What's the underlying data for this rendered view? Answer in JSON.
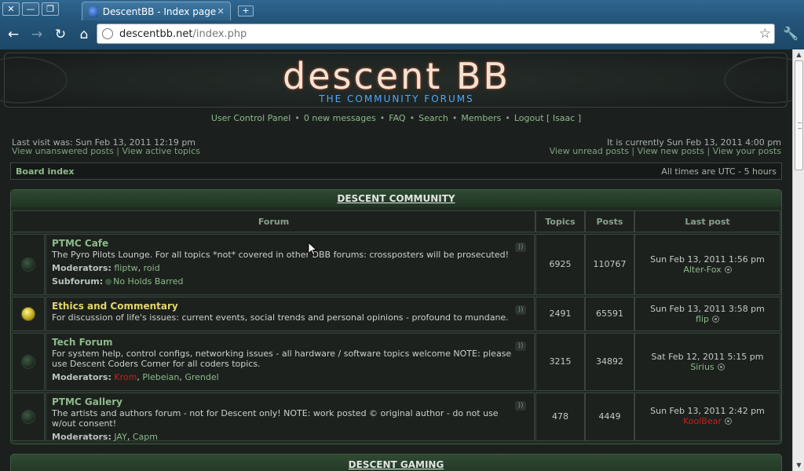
{
  "browser": {
    "tab_title": "DescentBB - Index page",
    "url_host": "descentbb.net",
    "url_path": "/index.php",
    "new_tab_symbol": "+"
  },
  "header": {
    "logo_main": "descent BB",
    "logo_sub": "THE COMMUNITY FORUMS"
  },
  "topnav": [
    {
      "label": "User Control Panel"
    },
    {
      "label": "0 new messages"
    },
    {
      "label": "FAQ"
    },
    {
      "label": "Search"
    },
    {
      "label": "Members"
    },
    {
      "label": "Logout [ Isaac ]"
    }
  ],
  "info": {
    "last_visit": "Last visit was: Sun Feb 13, 2011 12:19 pm",
    "view_unanswered": "View unanswered posts",
    "view_active": "View active topics",
    "current_time": "It is currently Sun Feb 13, 2011 4:00 pm",
    "view_unread": "View unread posts",
    "view_new": "View new posts",
    "view_yours": "View your posts"
  },
  "breadcrumbs": {
    "board_index": "Board index",
    "timezone": "All times are UTC - 5 hours"
  },
  "categories": [
    {
      "title": "DESCENT COMMUNITY"
    },
    {
      "title": "DESCENT GAMING"
    }
  ],
  "columns": {
    "forum": "Forum",
    "topics": "Topics",
    "posts": "Posts",
    "last_post": "Last post"
  },
  "labels": {
    "moderators": "Moderators:",
    "subforum": "Subforum:"
  },
  "forums": [
    {
      "name": "PTMC Cafe",
      "description": "The Pyro Pilots Lounge. For all topics *not* covered in other DBB forums: crossposters will be prosecuted!",
      "moderators": [
        "fliptw",
        "roid"
      ],
      "subforum": "No Holds Barred",
      "topics": "6925",
      "posts": "110767",
      "last_post_time": "Sun Feb 13, 2011 1:56 pm",
      "last_post_user": "Alter-Fox"
    },
    {
      "name": "Ethics and Commentary",
      "description": "For discussion of life's issues: current events, social trends and personal opinions - profound to mundane.",
      "topics": "2491",
      "posts": "65591",
      "last_post_time": "Sun Feb 13, 2011 3:58 pm",
      "last_post_user": "flip"
    },
    {
      "name": "Tech Forum",
      "description": "For system help, control configs, networking issues - all hardware / software topics welcome NOTE: please use Descent Coders Corner for all coders topics.",
      "moderators": [
        "Krom",
        "Plebeian",
        "Grendel"
      ],
      "topics": "3215",
      "posts": "34892",
      "last_post_time": "Sat Feb 12, 2011 5:15 pm",
      "last_post_user": "Sirius"
    },
    {
      "name": "PTMC Gallery",
      "description": "The artists and authors forum - not for Descent only! NOTE: work posted © original author - do not use w/out consent!",
      "moderators": [
        "JAY",
        "Capm"
      ],
      "topics": "478",
      "posts": "4449",
      "last_post_time": "Sun Feb 13, 2011 2:42 pm",
      "last_post_user": "KoolBear"
    }
  ],
  "colors": {
    "link_green": "#8dba8a",
    "admin_red": "#c0201a",
    "unread_yellow": "#e4d56a"
  }
}
